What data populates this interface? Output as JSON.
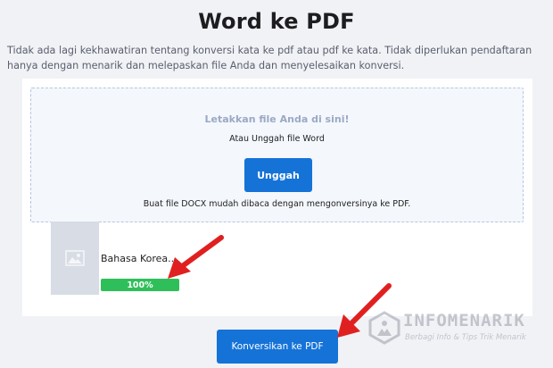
{
  "header": {
    "title": "Word ke PDF",
    "description": "Tidak ada lagi kekhawatiran tentang konversi kata ke pdf atau pdf ke kata. Tidak diperlukan pendaftaran hanya dengan menarik dan melepaskan file Anda dan menyelesaikan konversi."
  },
  "dropzone": {
    "title": "Letakkan file Anda di sini!",
    "subtitle": "Atau Unggah file Word",
    "upload_label": "Unggah",
    "note": "Buat file DOCX mudah dibaca dengan mengonversinya ke PDF."
  },
  "file": {
    "name": "Bahasa Korea..",
    "progress_label": "100%",
    "progress_fraction": 1.0,
    "thumbnail_icon": "image-placeholder-icon"
  },
  "actions": {
    "convert_label": "Konversikan ke PDF"
  },
  "watermark": {
    "name": "INFOMENARIK",
    "tagline": "Berbagi Info & Tips Trik Menarik"
  },
  "colors": {
    "accent": "#1573d8",
    "progress": "#2fbf5a",
    "arrow": "#e02020",
    "background": "#f1f2f6"
  }
}
